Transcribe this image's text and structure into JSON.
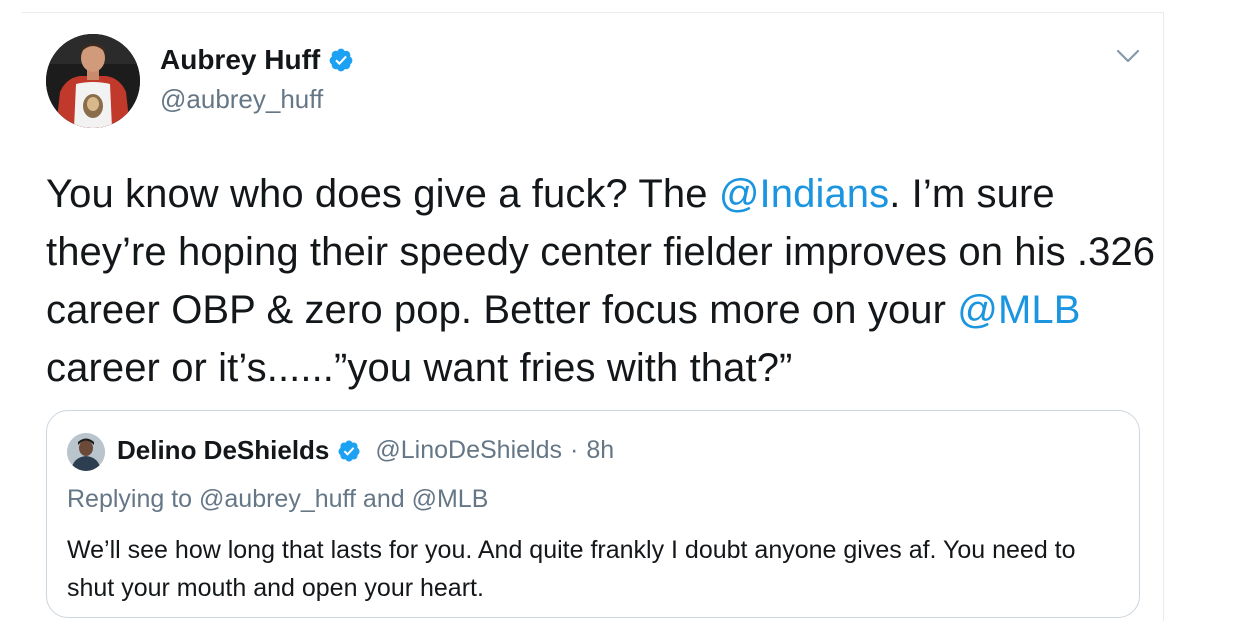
{
  "tweet": {
    "author": {
      "display_name": "Aubrey Huff",
      "handle": "@aubrey_huff",
      "verified": true
    },
    "text_parts": [
      {
        "text": "You know who does give a fuck? The ",
        "type": "text"
      },
      {
        "text": "@Indians",
        "type": "mention"
      },
      {
        "text": ". I’m sure they’re hoping their speedy center fielder improves on his .326 career OBP & zero pop. Better focus more on your ",
        "type": "text"
      },
      {
        "text": "@MLB",
        "type": "mention"
      },
      {
        "text": " career or it’s......”you want fries with that?”",
        "type": "text"
      }
    ]
  },
  "quoted_tweet": {
    "author": {
      "display_name": "Delino DeShields",
      "handle": "@LinoDeShields",
      "verified": true
    },
    "separator": "·",
    "time": "8h",
    "replying_to": "Replying to @aubrey_huff and @MLB",
    "text": "We’ll see how long that lasts for you. And quite frankly I doubt anyone gives af. You need to shut your mouth and open your heart."
  },
  "icons": {
    "verified": "verified-badge-icon",
    "menu": "chevron-down-icon"
  },
  "colors": {
    "link": "#1b95e0",
    "verified": "#1da1f2",
    "secondary_text": "#657786",
    "primary_text": "#14171a",
    "border": "#ccd6dd"
  }
}
